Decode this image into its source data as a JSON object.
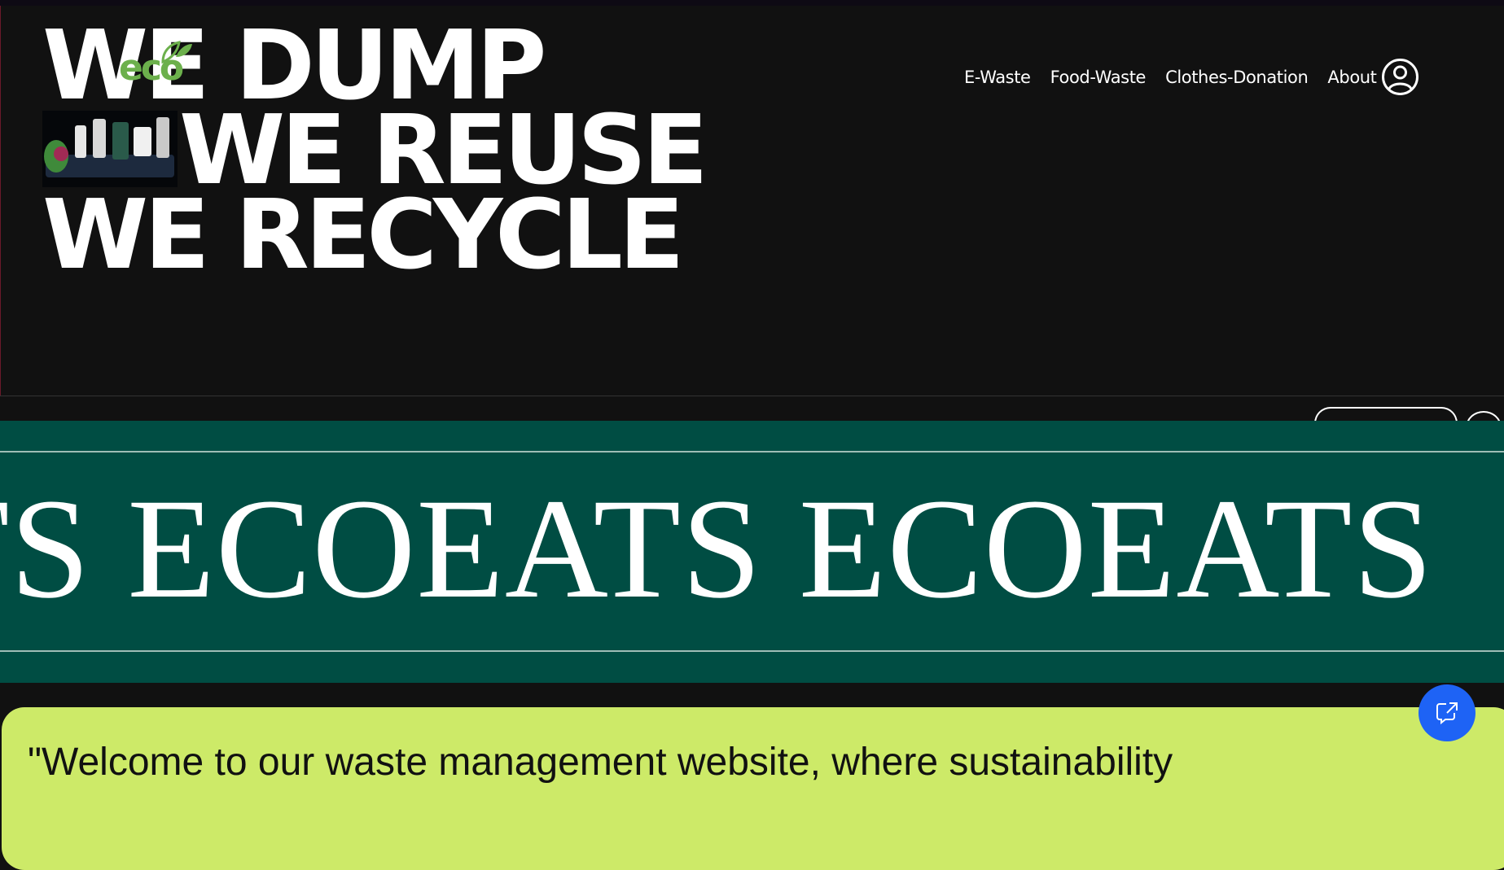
{
  "hero": {
    "line1": "WE DUMP",
    "line2": "WE REUSE",
    "line3": "WE RECYCLE"
  },
  "logo": {
    "text": "eco",
    "color": "#6cb04c"
  },
  "nav": {
    "items": [
      "E-Waste",
      "Food-Waste",
      "Clothes-Donation",
      "About"
    ],
    "user_icon": "user-circle-icon"
  },
  "marquee": {
    "text": "TS ECOEATS ECOEATS",
    "band_color": "#004d43"
  },
  "welcome": {
    "text": "\"Welcome to our waste management website, where sustainability",
    "card_color": "#cdea68"
  },
  "chat": {
    "icon": "external-chat-icon",
    "color": "#1e63f5"
  }
}
